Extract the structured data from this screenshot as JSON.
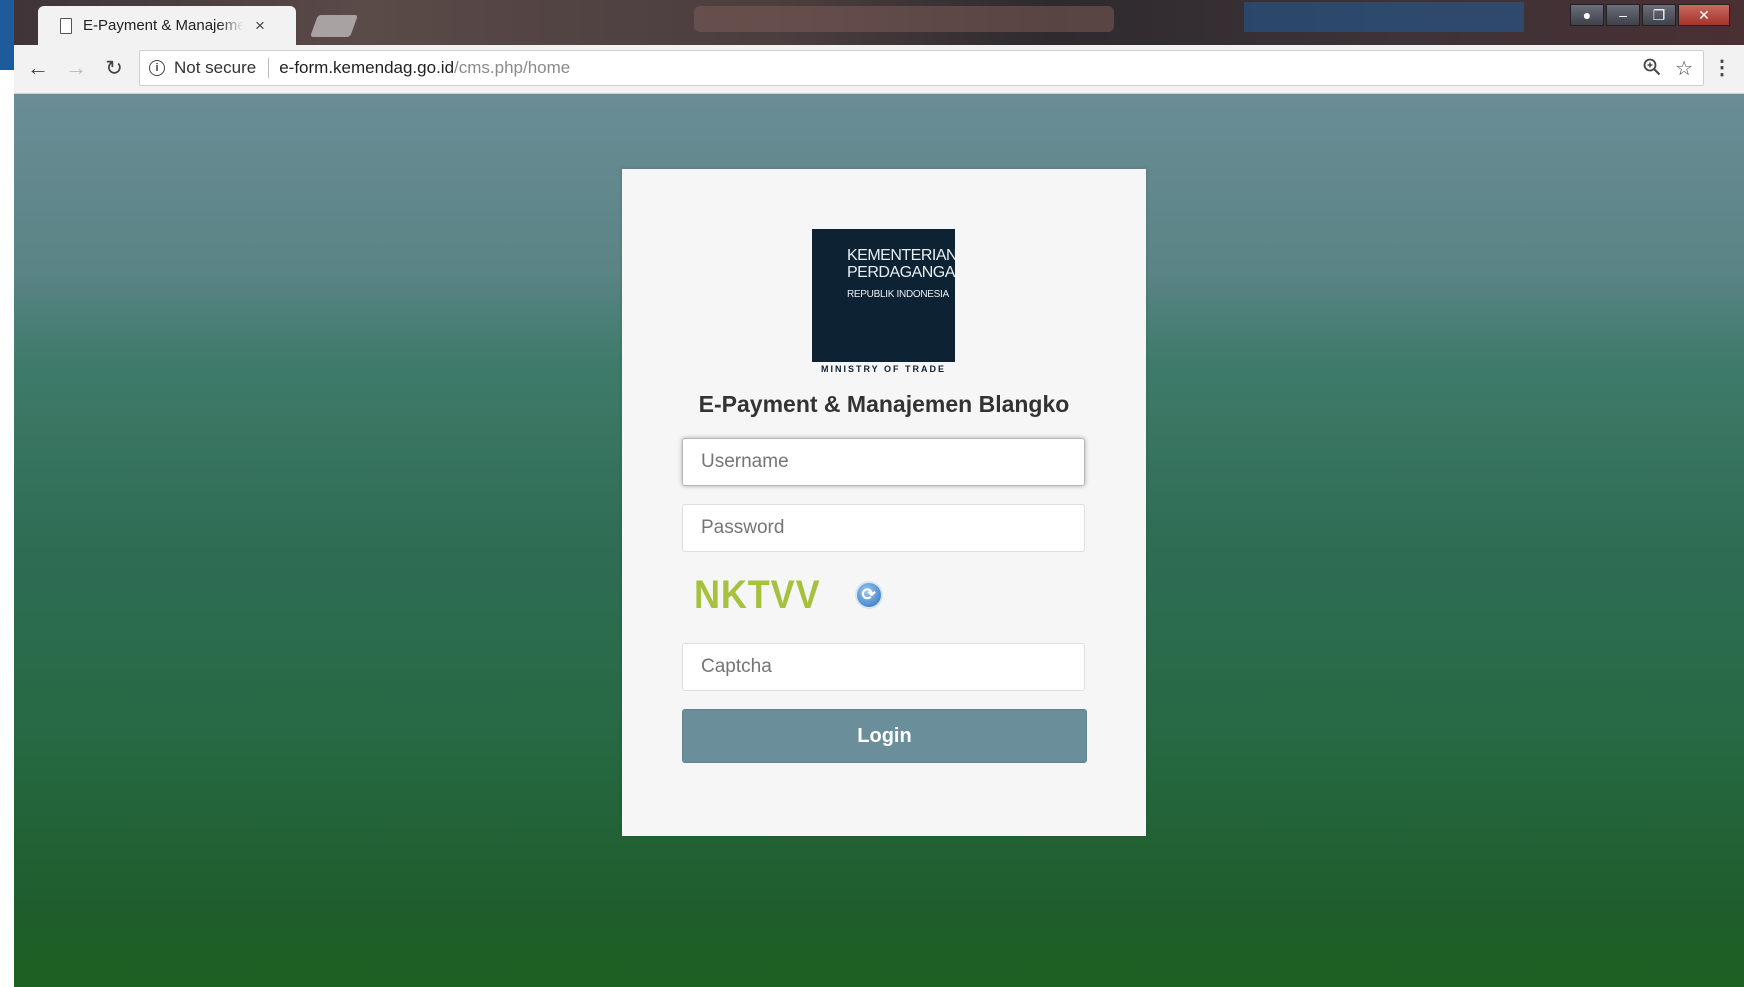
{
  "browser": {
    "tab_title": "E-Payment & Manajemen Blangko",
    "tab_close": "×",
    "omnibox": {
      "security_label": "Not secure",
      "url_host": "e-form.kemendag.go.id",
      "url_path": "/cms.php/home"
    },
    "icons": {
      "back": "←",
      "forward": "→",
      "reload": "↻",
      "zoom": "🔍",
      "star": "☆",
      "menu": "⋮",
      "info": "i"
    }
  },
  "logo": {
    "line1": "KEMENTERIAN",
    "line2": "PERDAGANGAN",
    "line3": "REPUBLIK INDONESIA",
    "caption": "MINISTRY OF TRADE"
  },
  "login": {
    "title": "E-Payment & Manajemen Blangko",
    "username_placeholder": "Username",
    "password_placeholder": "Password",
    "captcha_text": "NKTVV",
    "captcha_placeholder": "Captcha",
    "button_label": "Login"
  },
  "colors": {
    "login_button": "#6b8e9b",
    "captcha": "#a5c13e",
    "logo_bg": "#0d2233"
  }
}
